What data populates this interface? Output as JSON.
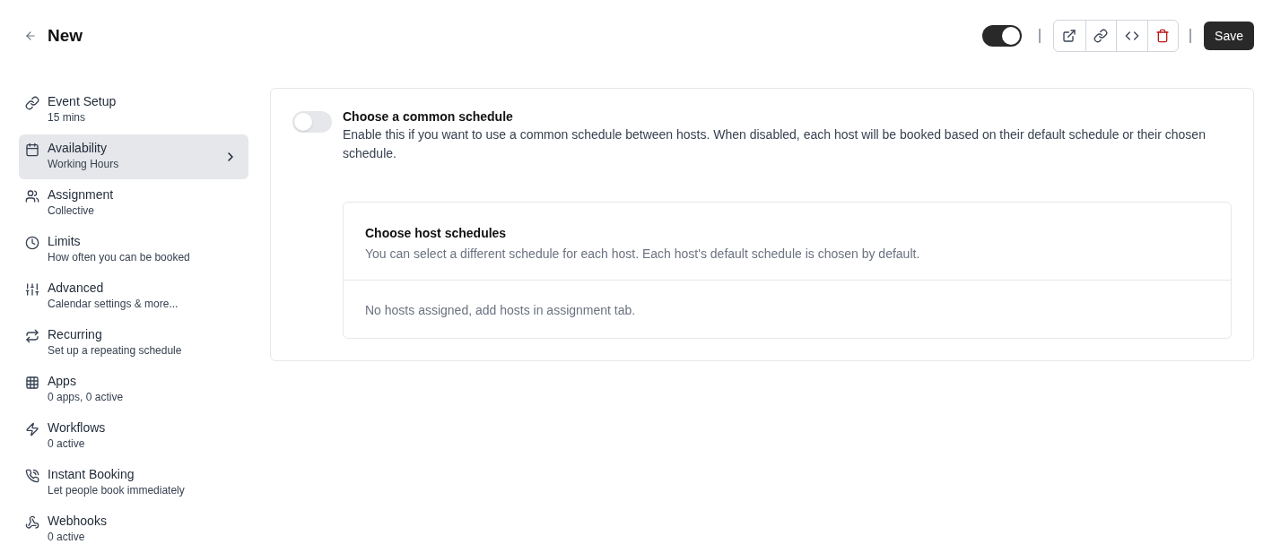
{
  "header": {
    "title": "New",
    "enabled": true,
    "save_label": "Save"
  },
  "sidebar": {
    "items": [
      {
        "title": "Event Setup",
        "subtitle": "15 mins",
        "selected": false
      },
      {
        "title": "Availability",
        "subtitle": "Working Hours",
        "selected": true
      },
      {
        "title": "Assignment",
        "subtitle": "Collective",
        "selected": false
      },
      {
        "title": "Limits",
        "subtitle": "How often you can be booked",
        "selected": false
      },
      {
        "title": "Advanced",
        "subtitle": "Calendar settings & more...",
        "selected": false
      },
      {
        "title": "Recurring",
        "subtitle": "Set up a repeating schedule",
        "selected": false
      },
      {
        "title": "Apps",
        "subtitle": "0 apps, 0 active",
        "selected": false
      },
      {
        "title": "Workflows",
        "subtitle": "0 active",
        "selected": false
      },
      {
        "title": "Instant Booking",
        "subtitle": "Let people book immediately",
        "selected": false
      },
      {
        "title": "Webhooks",
        "subtitle": "0 active",
        "selected": false
      }
    ]
  },
  "common_schedule": {
    "title": "Choose a common schedule",
    "description": "Enable this if you want to use a common schedule between hosts. When disabled, each host will be booked based on their default schedule or their chosen schedule.",
    "on": false
  },
  "host_schedules": {
    "title": "Choose host schedules",
    "description": "You can select a different schedule for each host. Each host's default schedule is chosen by default.",
    "empty_message": "No hosts assigned, add hosts in assignment tab."
  }
}
